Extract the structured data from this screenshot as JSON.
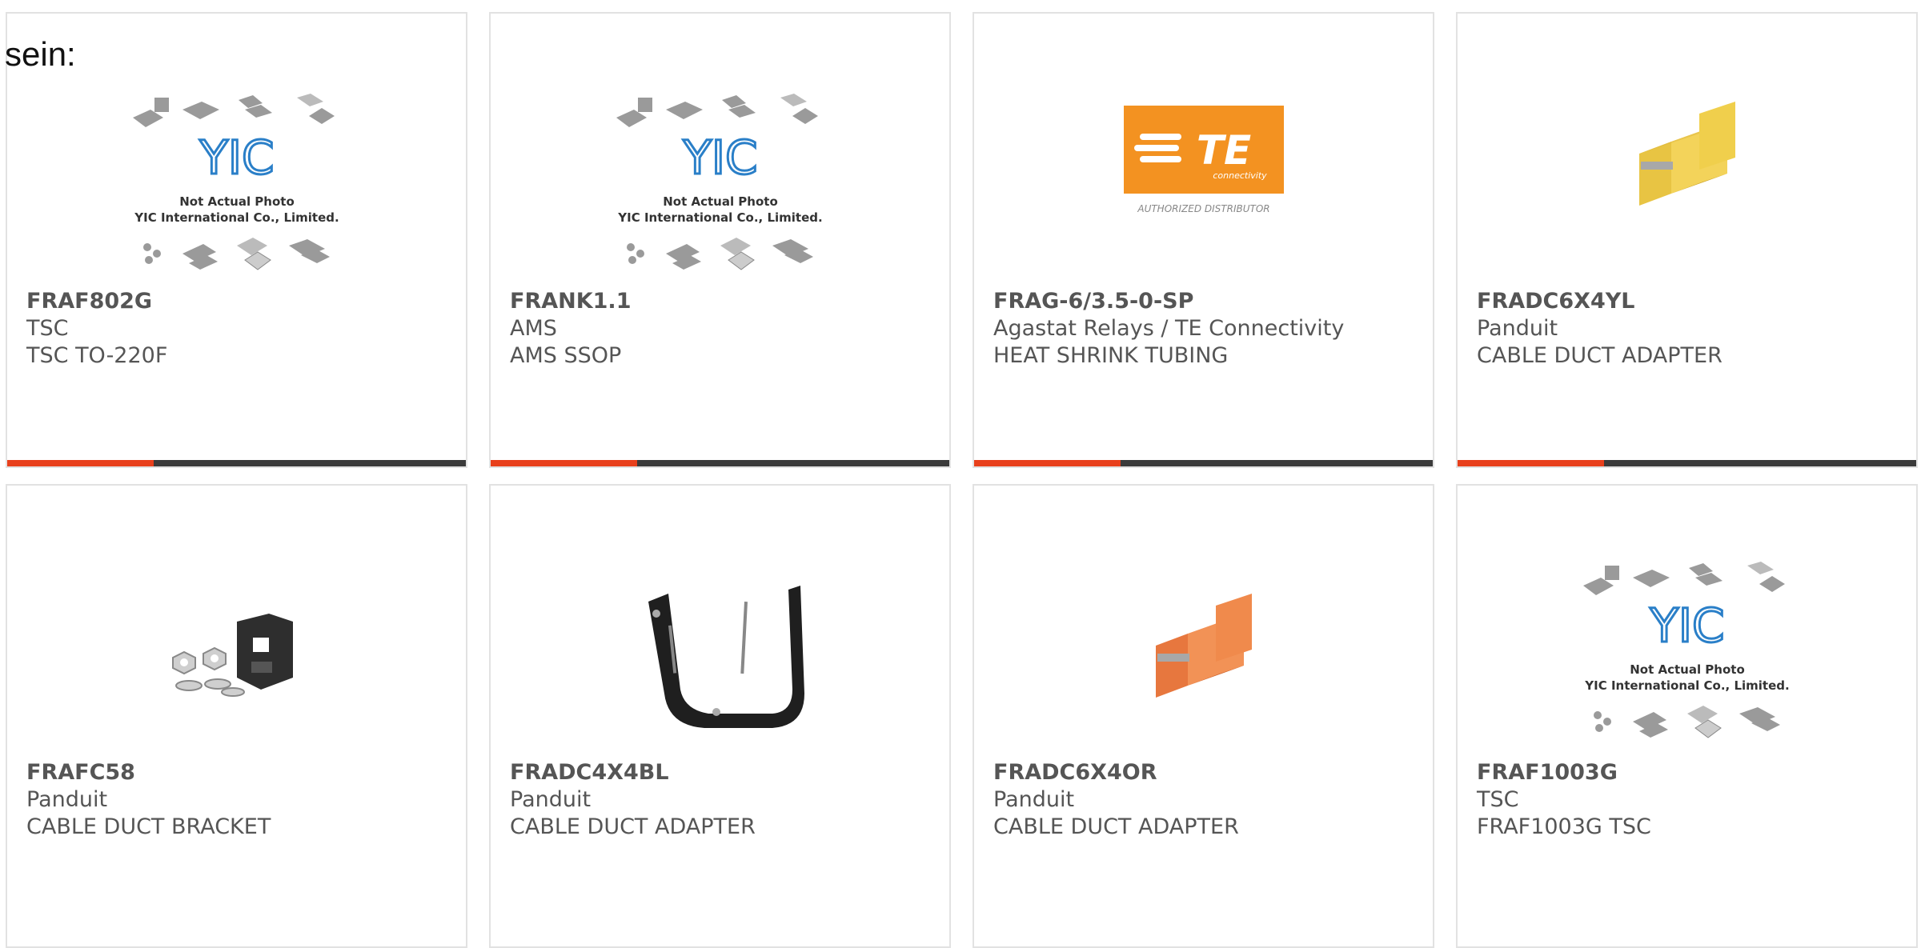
{
  "lead_text": "sein:",
  "placeholder_image": {
    "brand": "YIC",
    "caption_line1": "Not Actual Photo",
    "caption_line2": "YIC International Co., Limited."
  },
  "te_image": {
    "logo_text": "TE",
    "logo_sub": "connectivity",
    "caption": "AUTHORIZED DISTRIBUTOR"
  },
  "colors": {
    "accent": "#e8401c",
    "bar_dark": "#3b3b3b",
    "text": "#555555",
    "te_orange": "#f39221"
  },
  "products": [
    {
      "part": "FRAF802G",
      "manufacturer": "TSC",
      "description": "TSC TO-220F",
      "image": "yic-placeholder"
    },
    {
      "part": "FRANK1.1",
      "manufacturer": "AMS",
      "description": "AMS SSOP",
      "image": "yic-placeholder"
    },
    {
      "part": "FRAG-6/3.5-0-SP",
      "manufacturer": "Agastat Relays / TE Connectivity",
      "description": "HEAT SHRINK TUBING",
      "image": "te-logo"
    },
    {
      "part": "FRADC6X4YL",
      "manufacturer": "Panduit",
      "description": "CABLE DUCT ADAPTER",
      "image": "yellow-duct-adapter"
    },
    {
      "part": "FRAFC58",
      "manufacturer": "Panduit",
      "description": "CABLE DUCT BRACKET",
      "image": "bracket-with-nuts"
    },
    {
      "part": "FRADC4X4BL",
      "manufacturer": "Panduit",
      "description": "CABLE DUCT ADAPTER",
      "image": "black-duct-adapter"
    },
    {
      "part": "FRADC6X4OR",
      "manufacturer": "Panduit",
      "description": "CABLE DUCT ADAPTER",
      "image": "orange-duct-adapter"
    },
    {
      "part": "FRAF1003G",
      "manufacturer": "TSC",
      "description": "FRAF1003G TSC",
      "image": "yic-placeholder"
    }
  ]
}
